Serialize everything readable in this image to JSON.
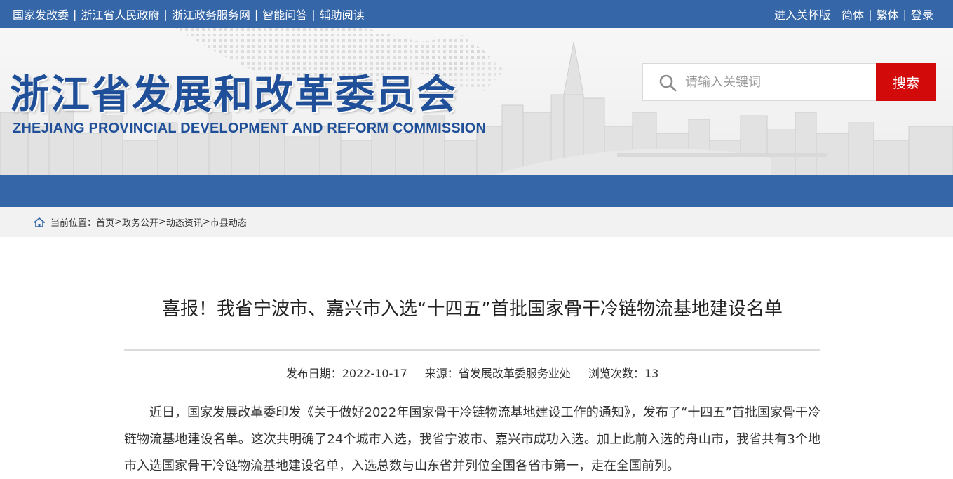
{
  "topbar": {
    "links_left": [
      "国家发改委",
      "浙江省人民政府",
      "浙江政务服务网",
      "智能问答",
      "辅助阅读"
    ],
    "care_mode": "进入关怀版",
    "simplified": "简体",
    "traditional": "繁体",
    "login": "登录"
  },
  "header": {
    "title_cn": "浙江省发展和改革委员会",
    "title_en": "ZHEJIANG PROVINCIAL DEVELOPMENT AND REFORM COMMISSION"
  },
  "search": {
    "placeholder": "请输入关键词",
    "button_label": "搜索"
  },
  "breadcrumb": {
    "prefix": "当前位置：",
    "items": [
      "首页",
      "政务公开",
      "动态资讯",
      "市县动态"
    ],
    "separator": ">"
  },
  "article": {
    "title": "喜报！我省宁波市、嘉兴市入选“十四五”首批国家骨干冷链物流基地建设名单",
    "date_label": "发布日期：",
    "date": "2022-10-17",
    "source_label": "来源：",
    "source": "省发展改革委服务业处",
    "views_label": "浏览次数：",
    "views": "13",
    "body": "近日，国家发展改革委印发《关于做好2022年国家骨干冷链物流基地建设工作的通知》，发布了“十四五”首批国家骨干冷链物流基地建设名单。这次共明确了24个城市入选，我省宁波市、嘉兴市成功入选。加上此前入选的舟山市，我省共有3个地市入选国家骨干冷链物流基地建设名单，入选总数与山东省并列位全国各省市第一，走在全国前列。"
  },
  "colors": {
    "brand_blue": "#3566a8",
    "title_blue": "#1f4f98",
    "search_red": "#d20a0a"
  }
}
